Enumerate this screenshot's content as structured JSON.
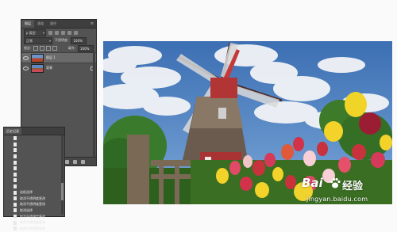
{
  "layers_panel": {
    "tabs": [
      "图层",
      "通道",
      "路径"
    ],
    "kind_filter": "ρ 类型",
    "blend_mode": "正常",
    "opacity_label": "不透明度:",
    "opacity_value": "100%",
    "lock_label": "锁定:",
    "fill_label": "填充:",
    "fill_value": "100%",
    "layers": [
      {
        "name": "图层 1",
        "selected": true
      },
      {
        "name": "背景",
        "selected": false
      }
    ]
  },
  "history_panel": {
    "tab": "历史记录",
    "items": [
      "",
      "",
      "",
      "",
      "",
      "",
      "",
      "",
      "",
      "选框选择",
      "取消不透明度更改",
      "取消不透明度更改",
      "取消选择",
      "取消不透明度更改",
      "取消不透明度更改",
      "取消不透明度更改"
    ]
  },
  "watermark": {
    "brand": "Bai",
    "brand_cn": "经验",
    "url": "jingyan.baidu.com"
  },
  "colors": {
    "panel_bg": "#535353",
    "panel_dark": "#3e3e3e",
    "sky": "#3f73b6",
    "tulip_red": "#c8323c",
    "tulip_yellow": "#f3d22a"
  }
}
